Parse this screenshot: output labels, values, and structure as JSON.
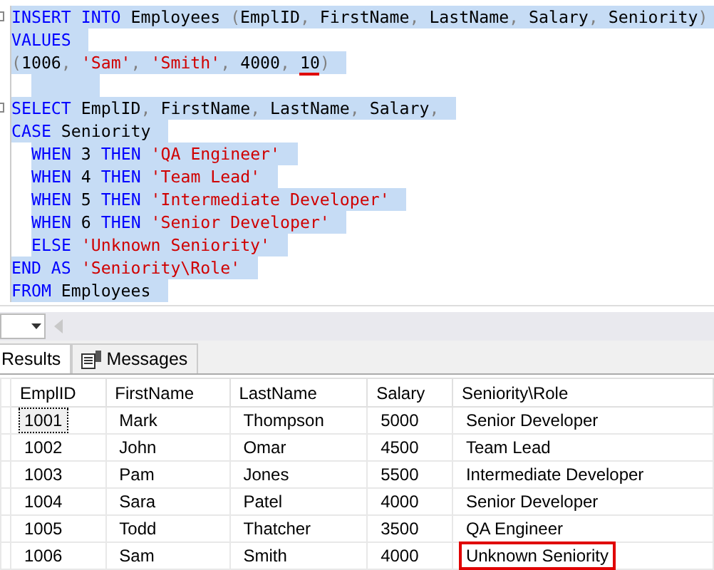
{
  "editor": {
    "lines": [
      {
        "collapsible": true,
        "indented": false,
        "tokens": [
          {
            "kind": "keyword",
            "text": "INSERT INTO"
          },
          {
            "kind": "plain",
            "text": " Employees "
          },
          {
            "kind": "punct",
            "text": "("
          },
          {
            "kind": "plain",
            "text": "EmplID"
          },
          {
            "kind": "punct",
            "text": ", "
          },
          {
            "kind": "plain",
            "text": "FirstName"
          },
          {
            "kind": "punct",
            "text": ", "
          },
          {
            "kind": "plain",
            "text": "LastName"
          },
          {
            "kind": "punct",
            "text": ", "
          },
          {
            "kind": "plain",
            "text": "Salary"
          },
          {
            "kind": "punct",
            "text": ", "
          },
          {
            "kind": "plain",
            "text": "Seniority"
          },
          {
            "kind": "punct",
            "text": ")"
          }
        ]
      },
      {
        "collapsible": false,
        "indented": false,
        "tokens": [
          {
            "kind": "keyword",
            "text": "VALUES"
          }
        ]
      },
      {
        "collapsible": false,
        "indented": false,
        "tokens": [
          {
            "kind": "punct",
            "text": "("
          },
          {
            "kind": "plain",
            "text": "1006"
          },
          {
            "kind": "punct",
            "text": ", "
          },
          {
            "kind": "string",
            "text": "'Sam'"
          },
          {
            "kind": "punct",
            "text": ", "
          },
          {
            "kind": "string",
            "text": "'Smith'"
          },
          {
            "kind": "punct",
            "text": ", "
          },
          {
            "kind": "plain",
            "text": "4000"
          },
          {
            "kind": "punct",
            "text": ", "
          },
          {
            "kind": "plain",
            "text": "10",
            "underlined": true
          },
          {
            "kind": "punct",
            "text": ")"
          }
        ]
      },
      {
        "collapsible": false,
        "indented": true
      },
      {
        "collapsible": true,
        "indented": false,
        "tokens": [
          {
            "kind": "keyword",
            "text": "SELECT"
          },
          {
            "kind": "plain",
            "text": " EmplID"
          },
          {
            "kind": "punct",
            "text": ", "
          },
          {
            "kind": "plain",
            "text": "FirstName"
          },
          {
            "kind": "punct",
            "text": ", "
          },
          {
            "kind": "plain",
            "text": "LastName"
          },
          {
            "kind": "punct",
            "text": ", "
          },
          {
            "kind": "plain",
            "text": "Salary"
          },
          {
            "kind": "punct",
            "text": ","
          }
        ]
      },
      {
        "collapsible": false,
        "indented": false,
        "tokens": [
          {
            "kind": "keyword",
            "text": "CASE"
          },
          {
            "kind": "plain",
            "text": " Seniority"
          }
        ]
      },
      {
        "collapsible": false,
        "indented": true,
        "tokens": [
          {
            "kind": "keyword",
            "text": "WHEN"
          },
          {
            "kind": "plain",
            "text": " 3 "
          },
          {
            "kind": "keyword",
            "text": "THEN"
          },
          {
            "kind": "string",
            "text": " 'QA Engineer'"
          }
        ]
      },
      {
        "collapsible": false,
        "indented": true,
        "tokens": [
          {
            "kind": "keyword",
            "text": "WHEN"
          },
          {
            "kind": "plain",
            "text": " 4 "
          },
          {
            "kind": "keyword",
            "text": "THEN"
          },
          {
            "kind": "string",
            "text": " 'Team Lead'"
          }
        ]
      },
      {
        "collapsible": false,
        "indented": true,
        "tokens": [
          {
            "kind": "keyword",
            "text": "WHEN"
          },
          {
            "kind": "plain",
            "text": " 5 "
          },
          {
            "kind": "keyword",
            "text": "THEN"
          },
          {
            "kind": "string",
            "text": " 'Intermediate Developer'"
          }
        ]
      },
      {
        "collapsible": false,
        "indented": true,
        "tokens": [
          {
            "kind": "keyword",
            "text": "WHEN"
          },
          {
            "kind": "plain",
            "text": " 6 "
          },
          {
            "kind": "keyword",
            "text": "THEN"
          },
          {
            "kind": "string",
            "text": " 'Senior Developer'"
          }
        ]
      },
      {
        "collapsible": false,
        "indented": true,
        "tokens": [
          {
            "kind": "keyword",
            "text": "ELSE"
          },
          {
            "kind": "string",
            "text": " 'Unknown Seniority'"
          }
        ]
      },
      {
        "collapsible": false,
        "indented": false,
        "tokens": [
          {
            "kind": "keyword",
            "text": "END AS"
          },
          {
            "kind": "string",
            "text": " 'Seniority\\Role'"
          }
        ]
      },
      {
        "collapsible": false,
        "indented": false,
        "tokens": [
          {
            "kind": "keyword",
            "text": "FROM"
          },
          {
            "kind": "plain",
            "text": " Employees"
          }
        ]
      }
    ]
  },
  "tabs": [
    {
      "label": "Results",
      "selected": true
    },
    {
      "label": "Messages",
      "selected": false
    }
  ],
  "table": {
    "columns": [
      "EmplID",
      "FirstName",
      "LastName",
      "Salary",
      "Seniority\\Role"
    ],
    "rows": [
      {
        "focused": true,
        "highlighted": false,
        "cells": [
          "1001",
          "Mark",
          "Thompson",
          "5000",
          "Senior Developer"
        ]
      },
      {
        "focused": false,
        "highlighted": false,
        "cells": [
          "1002",
          "John",
          "Omar",
          "4500",
          "Team Lead"
        ]
      },
      {
        "focused": false,
        "highlighted": false,
        "cells": [
          "1003",
          "Pam",
          "Jones",
          "5500",
          "Intermediate Developer"
        ]
      },
      {
        "focused": false,
        "highlighted": false,
        "cells": [
          "1004",
          "Sara",
          "Patel",
          "4000",
          "Senior Developer"
        ]
      },
      {
        "focused": false,
        "highlighted": false,
        "cells": [
          "1005",
          "Todd",
          "Thatcher",
          "3500",
          "QA Engineer"
        ]
      },
      {
        "focused": false,
        "highlighted": true,
        "cells": [
          "1006",
          "Sam",
          "Smith",
          "4000",
          "Unknown Seniority"
        ]
      }
    ]
  }
}
